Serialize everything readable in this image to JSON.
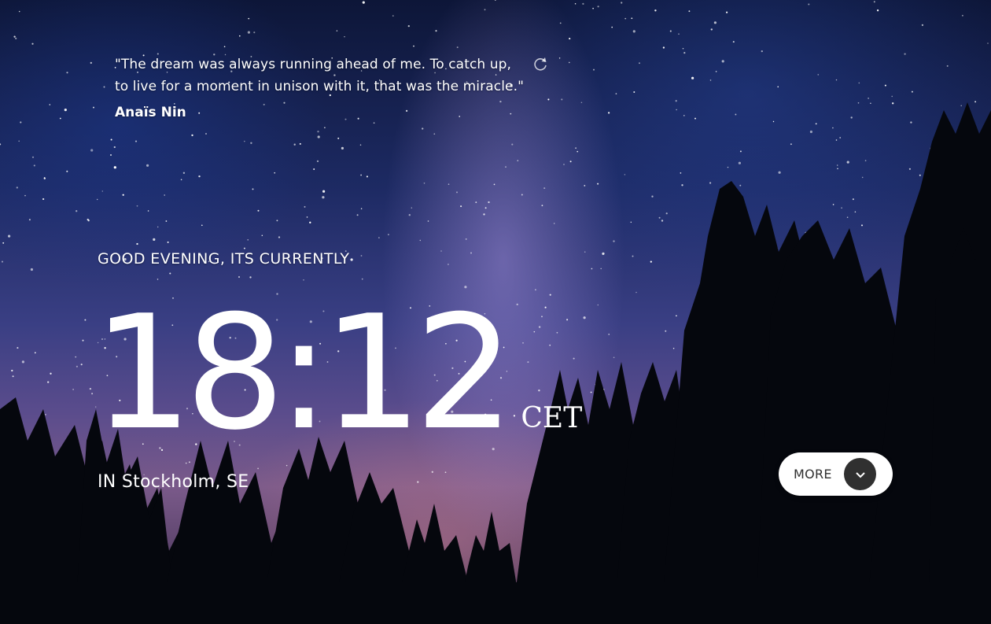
{
  "quote": {
    "text": "\"The dream was always running ahead of me. To catch up, to live for a moment in unison with it, that was the miracle.\"",
    "author": "Anaïs Nin"
  },
  "greeting": "GOOD EVENING, ITS CURRENTLY",
  "clock": {
    "time": "18:12",
    "timezone": "CET"
  },
  "location": {
    "prefix": "IN",
    "place": "Stockholm, SE"
  },
  "more_button": {
    "label": "MORE",
    "icon": "chevron-down-icon"
  },
  "icons": {
    "refresh": "refresh-icon"
  },
  "colors": {
    "text": "#ffffff",
    "button_bg": "#ffffff",
    "button_text": "#303030",
    "button_circle": "#303030"
  }
}
